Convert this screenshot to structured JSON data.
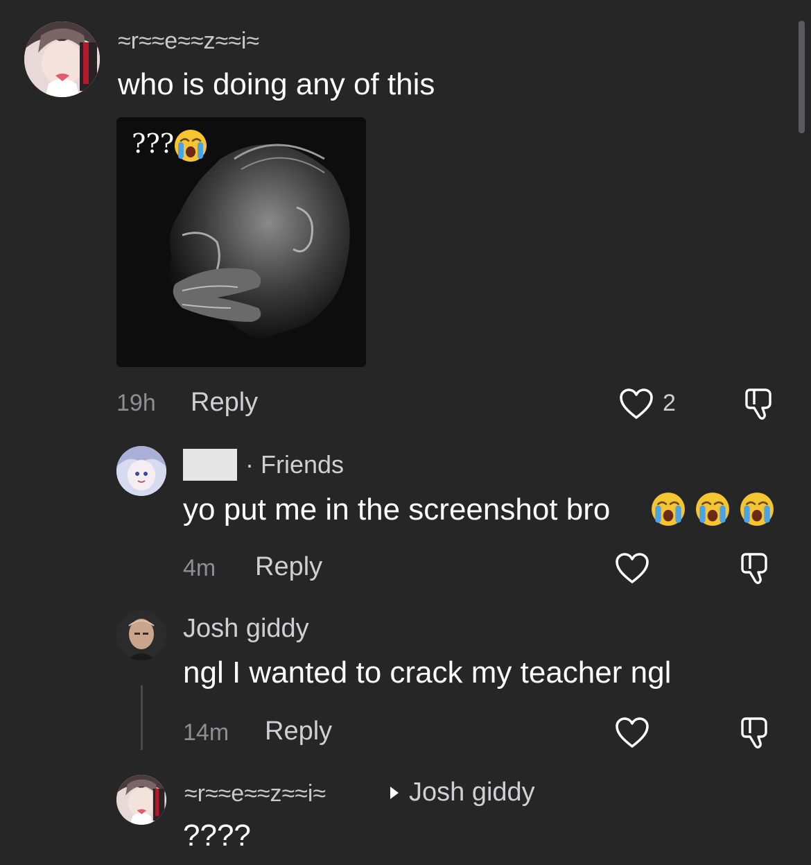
{
  "comments": [
    {
      "username": "≈r≈≈e≈≈z≈≈i≈",
      "text": "who is doing any of this",
      "image_caption": "???",
      "time": "19h",
      "reply_label": "Reply",
      "like_count": "2"
    },
    {
      "username": "",
      "tag": "· Friends",
      "text": "yo put me in the screenshot bro",
      "time": "4m",
      "reply_label": "Reply"
    },
    {
      "username": "Josh giddy",
      "text": "ngl I wanted to crack my teacher ngl",
      "time": "14m",
      "reply_label": "Reply"
    },
    {
      "username": "≈r≈≈e≈≈z≈≈i≈",
      "reply_to": "Josh giddy",
      "text": "????"
    }
  ],
  "colors": {
    "background": "#262627",
    "text": "#ffffff",
    "muted": "#8e8e93"
  }
}
